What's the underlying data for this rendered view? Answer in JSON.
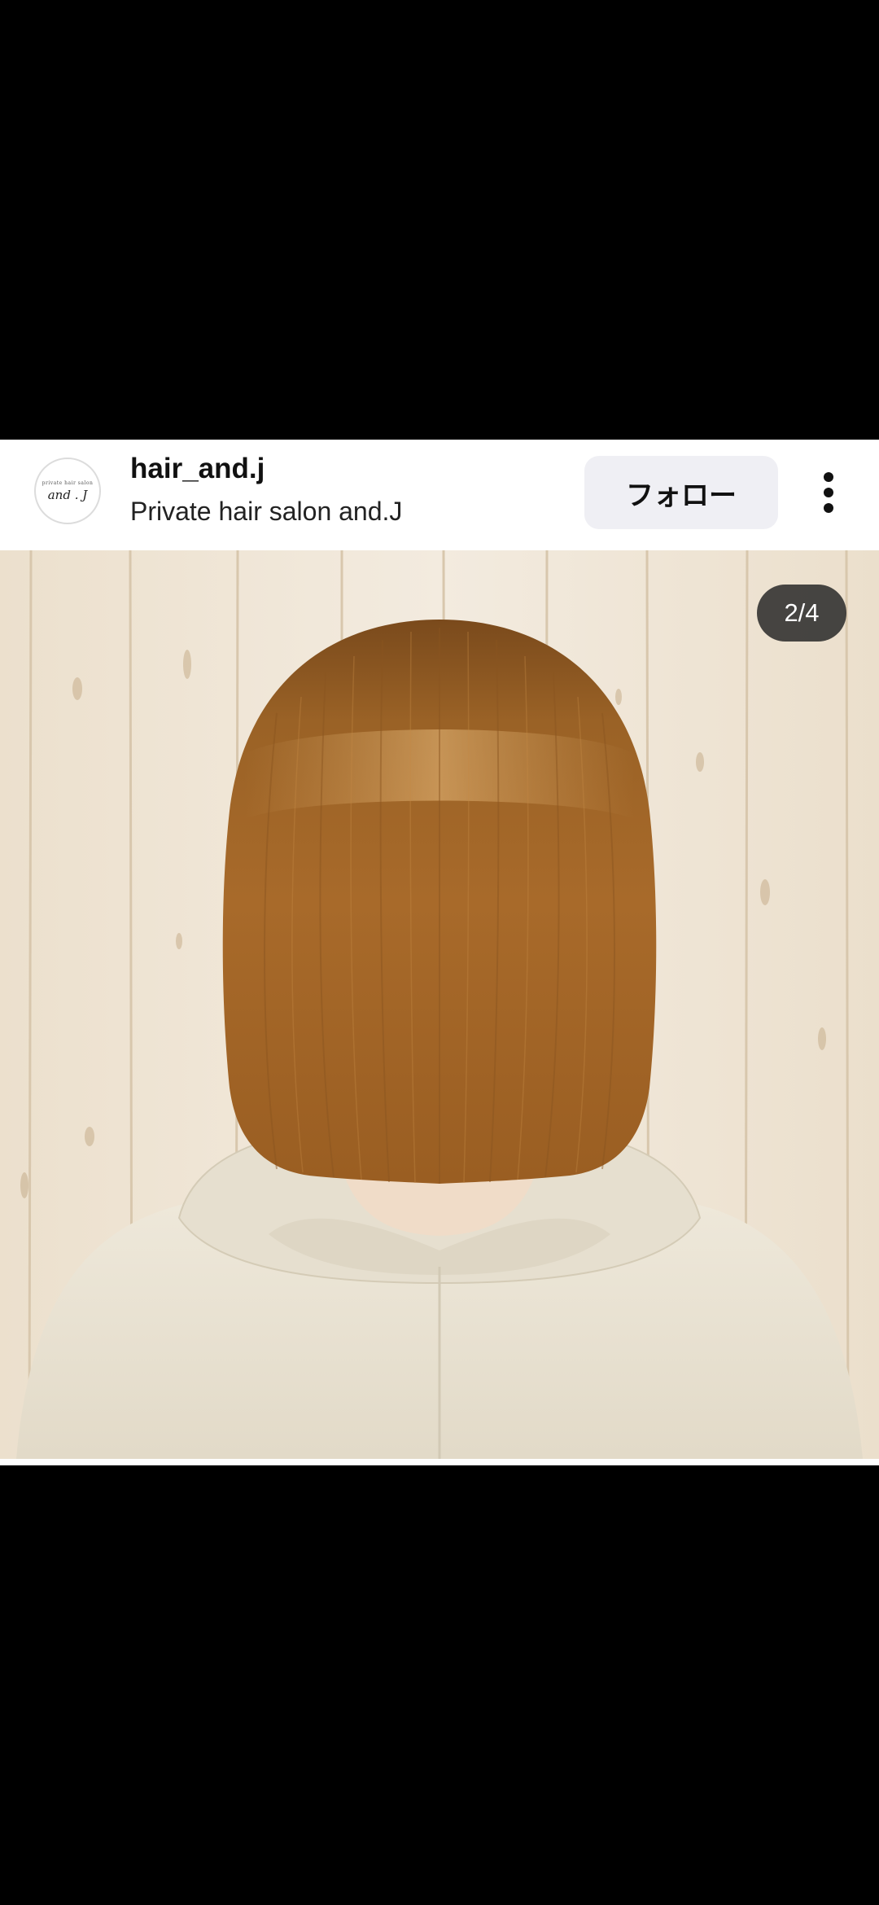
{
  "post": {
    "username": "hair_and.j",
    "subtitle": "Private hair salon and.J",
    "follow_label": "フォロー",
    "more_icon": "more-vertical-icon",
    "avatar": {
      "logo_text": "and . J",
      "tiny_text": "private hair salon"
    }
  },
  "media": {
    "page_indicator": "2/4",
    "current_page": 2,
    "total_pages": 4,
    "description": "Back view of a woman with a straight, shiny brown bob haircut wearing a cream knit hoodie against a whitewashed wood wall"
  },
  "colors": {
    "hair": "#a86a2a",
    "wall": "#efe4d4",
    "sweater": "#eae3d3",
    "follow_bg": "#efeff4"
  }
}
